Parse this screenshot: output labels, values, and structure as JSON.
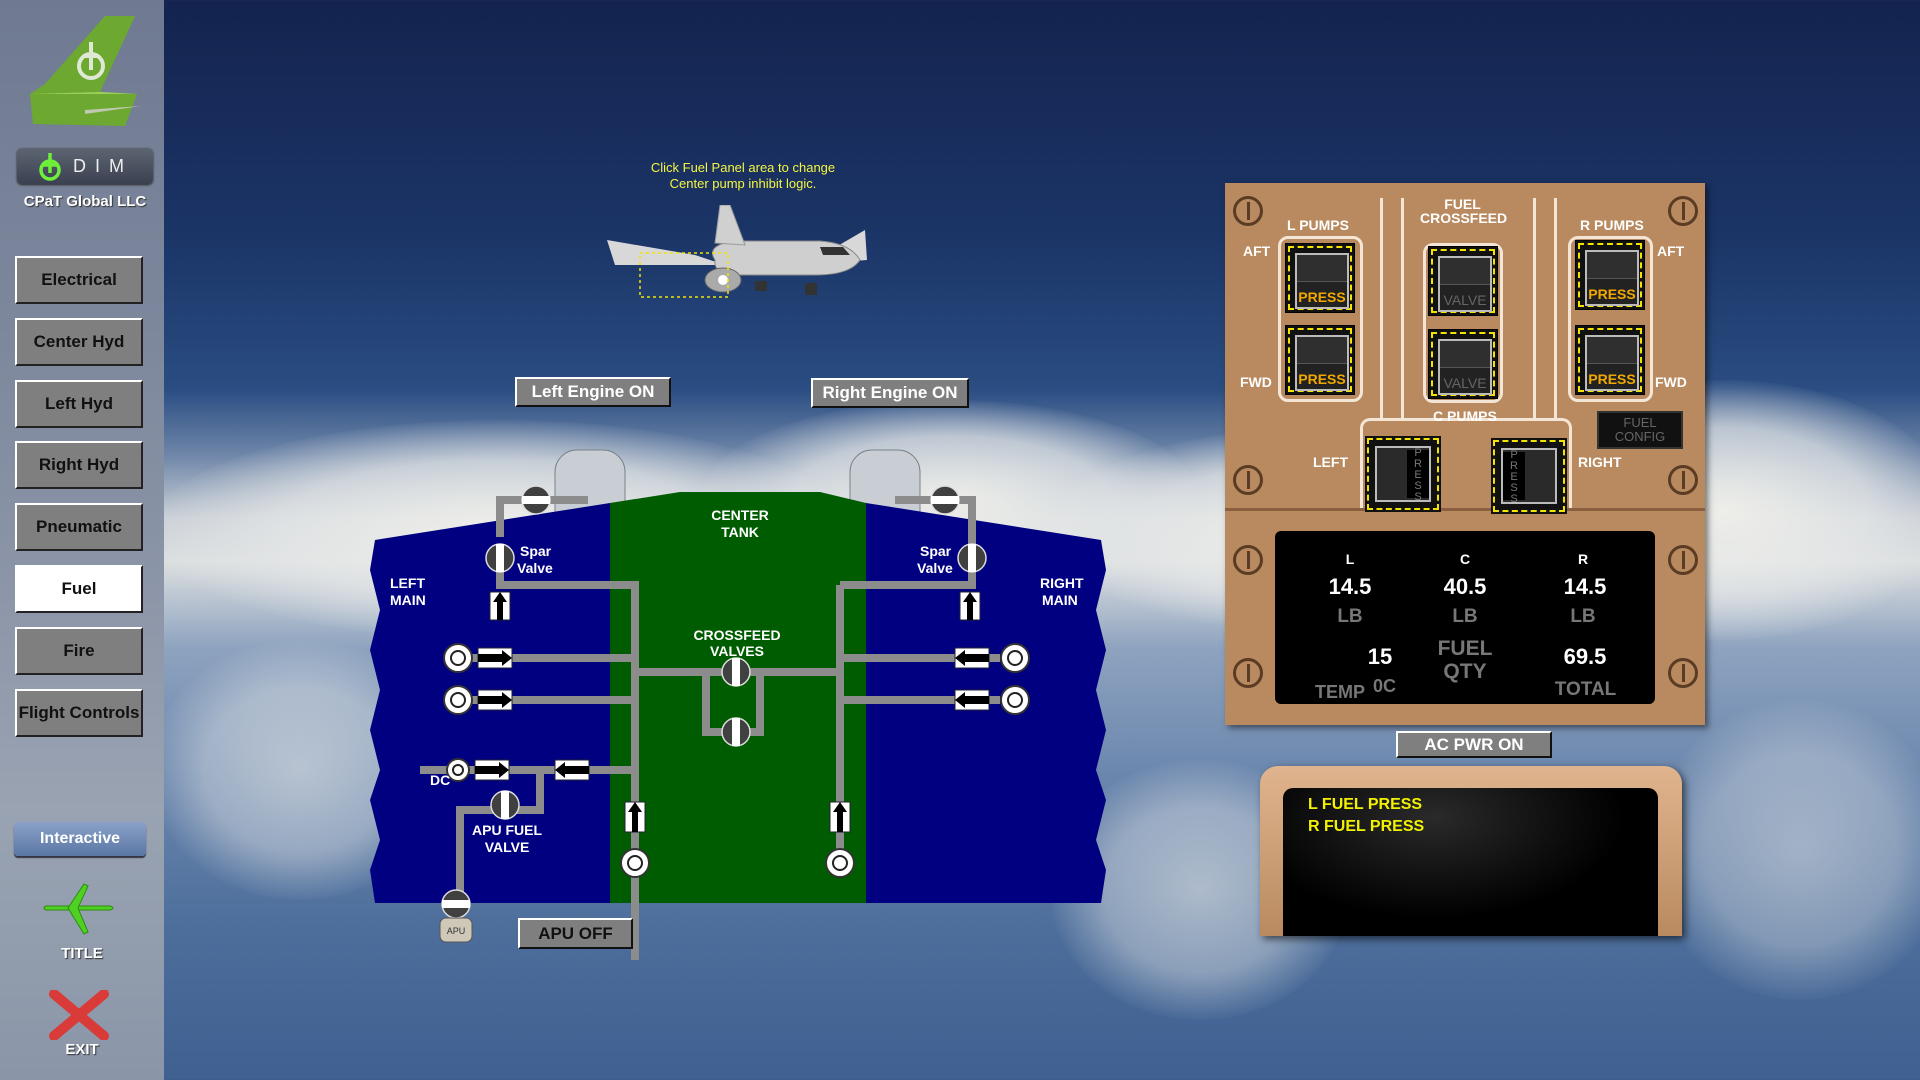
{
  "sidebar": {
    "dim_label": "DIM",
    "company": "CPaT Global LLC",
    "nav": [
      {
        "label": "Electrical",
        "active": false
      },
      {
        "label": "Center Hyd",
        "active": false
      },
      {
        "label": "Left Hyd",
        "active": false
      },
      {
        "label": "Right Hyd",
        "active": false
      },
      {
        "label": "Pneumatic",
        "active": false
      },
      {
        "label": "Fuel",
        "active": true
      },
      {
        "label": "Fire",
        "active": false
      },
      {
        "label": "Flight Controls",
        "active": false
      }
    ],
    "interactive_label": "Interactive",
    "title_label": "TITLE",
    "exit_label": "EXIT"
  },
  "hint": {
    "line1": "Click Fuel Panel area to change",
    "line2": "Center pump inhibit logic."
  },
  "engines": {
    "left_label": "Left Engine ON",
    "right_label": "Right Engine ON"
  },
  "schematic": {
    "left_tank": [
      "LEFT",
      "MAIN"
    ],
    "right_tank": [
      "RIGHT",
      "MAIN"
    ],
    "center_tank": [
      "CENTER",
      "TANK"
    ],
    "crossfeed": [
      "CROSSFEED",
      "VALVES"
    ],
    "spar_valve": [
      "Spar",
      "Valve"
    ],
    "apu_fuel_valve": [
      "APU FUEL",
      "VALVE"
    ],
    "dc_label": "DC",
    "apu_label": "APU",
    "colors": {
      "main_tank": "#000080",
      "center_tank": "#005c00",
      "pipe": "#8c8c8c"
    }
  },
  "apu": {
    "label": "APU OFF"
  },
  "fuel_panel": {
    "l_pumps": "L PUMPS",
    "r_pumps": "R PUMPS",
    "crossfeed": [
      "FUEL",
      "CROSSFEED"
    ],
    "aft": "AFT",
    "fwd": "FWD",
    "press": "PRESS",
    "valve": "VALVE",
    "c_pumps": "C PUMPS",
    "left": "LEFT",
    "right": "RIGHT",
    "fuel_config": [
      "FUEL",
      "CONFIG"
    ],
    "press_color": "#f0a800"
  },
  "fuel_qty": {
    "columns": [
      {
        "label": "L",
        "value": "14.5",
        "unit": "LB"
      },
      {
        "label": "C",
        "value": "40.5",
        "unit": "LB"
      },
      {
        "label": "R",
        "value": "14.5",
        "unit": "LB"
      }
    ],
    "temp_value": "15",
    "temp_label": "TEMP",
    "temp_unit": "0C",
    "title": [
      "FUEL",
      "QTY"
    ],
    "total_value": "69.5",
    "total_label": "TOTAL"
  },
  "ac_power": {
    "label": "AC PWR ON"
  },
  "eicas": {
    "messages": [
      "L FUEL PRESS",
      "R FUEL PRESS"
    ],
    "message_color": "#f2f200"
  }
}
